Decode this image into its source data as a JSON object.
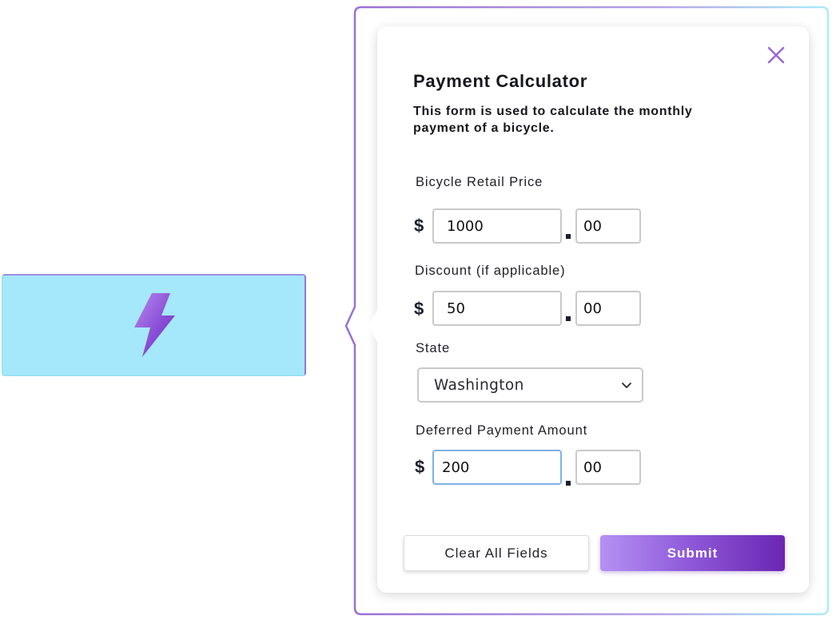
{
  "trigger": {
    "icon": "lightning-bolt-icon"
  },
  "dialog": {
    "close_icon": "close-icon",
    "title": "Payment Calculator",
    "subtitle": "This form is used to calculate the monthly payment of a bicycle."
  },
  "fields": {
    "retail_price": {
      "label": "Bicycle Retail Price",
      "currency_symbol": "$",
      "dollars": "1000",
      "cents": "00"
    },
    "discount": {
      "label": "Discount (if applicable)",
      "currency_symbol": "$",
      "dollars": "50",
      "cents": "00"
    },
    "state": {
      "label": "State",
      "selected": "Washington",
      "icon": "chevron-down-icon"
    },
    "deferred_payment": {
      "label": "Deferred Payment Amount",
      "currency_symbol": "$",
      "dollars": "200",
      "cents": "00"
    }
  },
  "actions": {
    "clear_label": "Clear All Fields",
    "submit_label": "Submit"
  },
  "colors": {
    "trigger_background": "#a6e8fb",
    "accent_purple": "#8d57d8",
    "focus_border": "#7fb1e6"
  }
}
